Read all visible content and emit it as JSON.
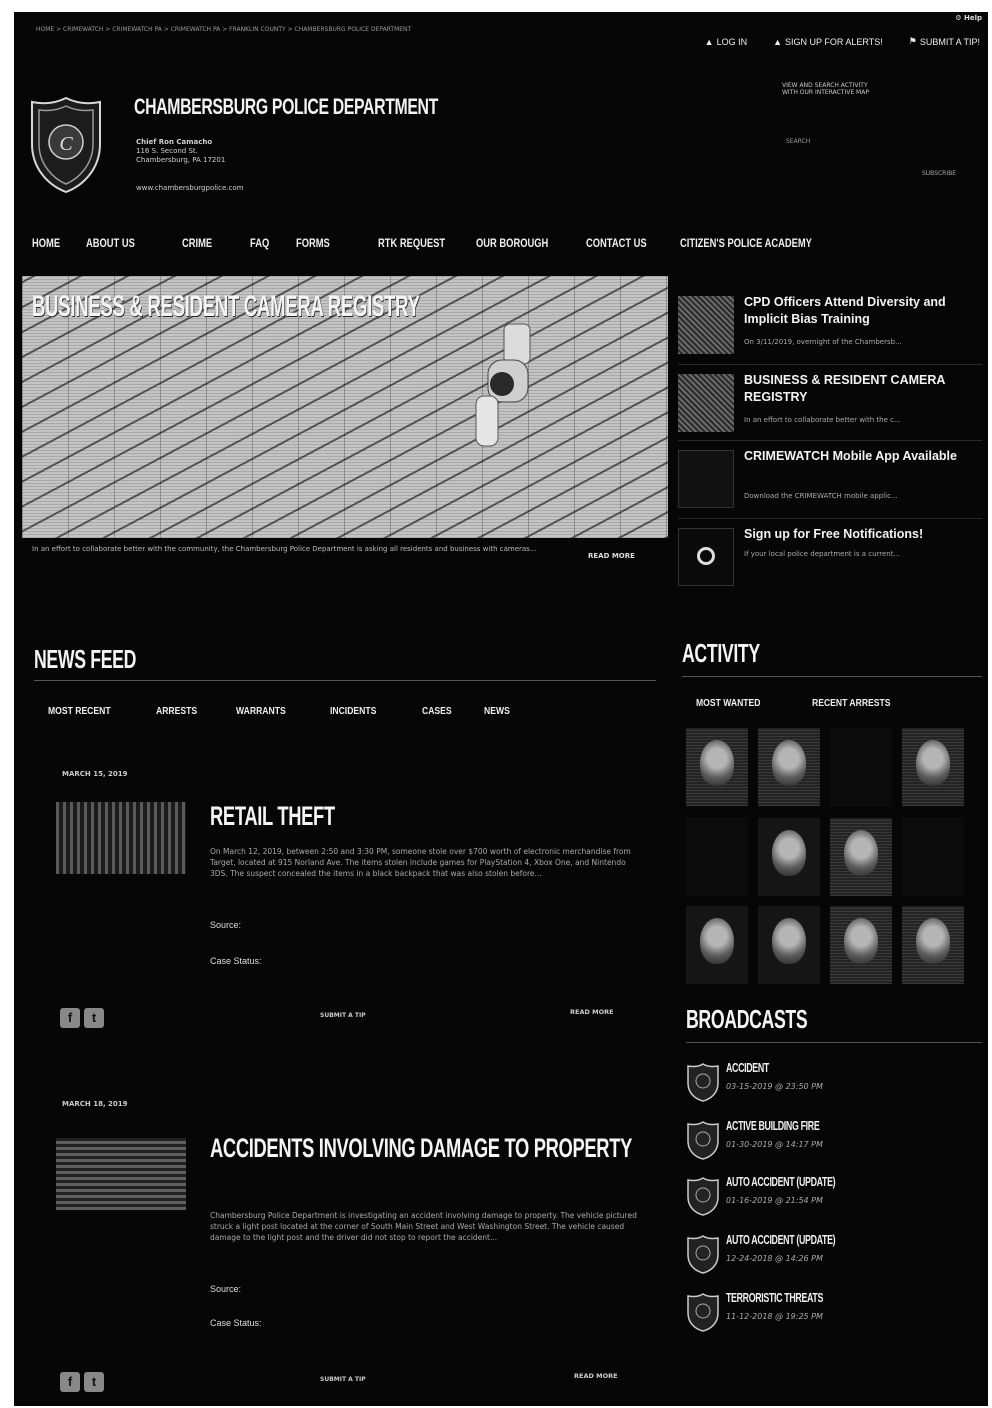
{
  "topbar": {
    "breadcrumb": "HOME > CRIMEWATCH > CRIMEWATCH PA > CRIMEWATCH PA > FRANKLIN COUNTY > CHAMBERSBURG POLICE DEPARTMENT",
    "help": "⚙ Help",
    "login": "LOG IN",
    "signup": "SIGN UP FOR ALERTS!",
    "submit_tip": "SUBMIT A TIP!"
  },
  "header": {
    "department_name": "CHAMBERSBURG POLICE DEPARTMENT",
    "chief": "Chief Ron Camacho",
    "address_line1": "116 S. Second St.",
    "address_line2": "Chambersburg, PA 17201",
    "website": "www.chambersburgpolice.com",
    "map_text": "VIEW AND SEARCH ACTIVITY WITH OUR INTERACTIVE MAP",
    "search_label": "SEARCH",
    "subscribe_label": "SUBSCRIBE"
  },
  "nav": [
    "HOME",
    "ABOUT US",
    "CRIME",
    "FAQ",
    "FORMS",
    "RTK REQUEST",
    "OUR BOROUGH",
    "CONTACT US",
    "CITIZEN'S POLICE ACADEMY"
  ],
  "hero": {
    "title": "BUSINESS & RESIDENT CAMERA REGISTRY",
    "caption": "In an effort to collaborate better with the community, the Chambersburg Police Department is asking all residents and business with cameras...",
    "read_more": "READ MORE"
  },
  "side_stories": [
    {
      "title": "CPD Officers Attend Diversity and Implicit Bias Training",
      "summary": "On 3/11/2019, overnight of the Chambersb..."
    },
    {
      "title": "BUSINESS & RESIDENT CAMERA REGISTRY",
      "summary": "In an effort to collaborate better with the c..."
    },
    {
      "title": "CRIMEWATCH Mobile App Available",
      "summary": "Download the CRIMEWATCH mobile applic..."
    },
    {
      "title": "Sign up for Free Notifications!",
      "summary": "If your local police department is a current..."
    }
  ],
  "news_feed": {
    "heading": "NEWS FEED",
    "tabs": [
      "MOST RECENT",
      "ARRESTS",
      "WARRANTS",
      "INCIDENTS",
      "CASES",
      "NEWS"
    ],
    "items": [
      {
        "date": "MARCH 15, 2019",
        "title": "RETAIL THEFT",
        "body": "On March 12, 2019, between 2:50 and 3:30 PM, someone stole over $700 worth of electronic merchandise from Target, located at 915 Norland Ave. The items stolen include games for PlayStation 4, Xbox One, and Nintendo 3DS. The suspect concealed the items in a black backpack that was also stolen before...",
        "source_label": "Source:",
        "status_label": "Case Status:",
        "submit_tip": "SUBMIT A TIP",
        "read_more": "READ MORE"
      },
      {
        "date": "MARCH 18, 2019",
        "title": "ACCIDENTS INVOLVING DAMAGE TO PROPERTY",
        "body": "Chambersburg Police Department is investigating an accident involving damage to property. The vehicle pictured struck a light post located at the corner of South Main Street and West Washington Street. The vehicle caused damage to the light post and the driver did not stop to report the accident...",
        "source_label": "Source:",
        "status_label": "Case Status:",
        "submit_tip": "SUBMIT A TIP",
        "read_more": "READ MORE"
      }
    ]
  },
  "activity": {
    "heading": "ACTIVITY",
    "tabs": [
      "MOST WANTED",
      "RECENT ARRESTS"
    ]
  },
  "broadcasts": {
    "heading": "BROADCASTS",
    "items": [
      {
        "title": "ACCIDENT",
        "time": "03-15-2019 @ 23:50 PM"
      },
      {
        "title": "ACTIVE BUILDING FIRE",
        "time": "01-30-2019 @ 14:17 PM"
      },
      {
        "title": "AUTO ACCIDENT (UPDATE)",
        "time": "01-16-2019 @ 21:54 PM"
      },
      {
        "title": "AUTO ACCIDENT (UPDATE)",
        "time": "12-24-2018 @ 14:26 PM"
      },
      {
        "title": "TERRORISTIC THREATS",
        "time": "11-12-2018 @ 19:25 PM"
      }
    ]
  }
}
